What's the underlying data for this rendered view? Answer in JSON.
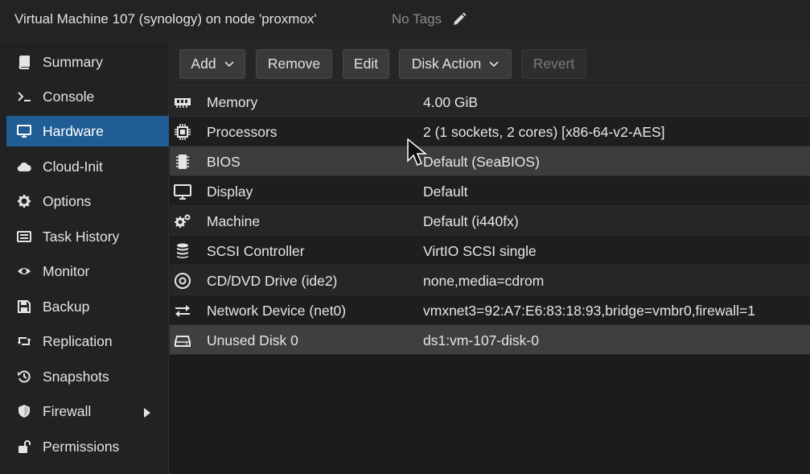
{
  "window": {
    "title": "Virtual Machine 107 (synology) on node 'proxmox'",
    "tags_label": "No Tags",
    "tags_icon": "pencil-icon"
  },
  "sidebar": {
    "items": [
      {
        "label": "Summary",
        "icon": "book-icon"
      },
      {
        "label": "Console",
        "icon": "terminal-icon"
      },
      {
        "label": "Hardware",
        "icon": "monitor-icon",
        "active": true
      },
      {
        "label": "Cloud-Init",
        "icon": "cloud-icon"
      },
      {
        "label": "Options",
        "icon": "gear-icon"
      },
      {
        "label": "Task History",
        "icon": "list-icon"
      },
      {
        "label": "Monitor",
        "icon": "eye-icon"
      },
      {
        "label": "Backup",
        "icon": "floppy-icon"
      },
      {
        "label": "Replication",
        "icon": "retweet-icon"
      },
      {
        "label": "Snapshots",
        "icon": "history-icon"
      },
      {
        "label": "Firewall",
        "icon": "shield-icon",
        "submenu": true
      },
      {
        "label": "Permissions",
        "icon": "unlock-icon"
      }
    ],
    "active_color": "#1f5d94"
  },
  "toolbar": {
    "add_label": "Add",
    "remove_label": "Remove",
    "edit_label": "Edit",
    "disk_action_label": "Disk Action",
    "revert_label": "Revert",
    "revert_disabled": true
  },
  "hardware": {
    "rows": [
      {
        "key": "Memory",
        "value": "4.00 GiB",
        "icon": "memory-icon"
      },
      {
        "key": "Processors",
        "value": "2 (1 sockets, 2 cores) [x86-64-v2-AES]",
        "icon": "cpu-icon"
      },
      {
        "key": "BIOS",
        "value": "Default (SeaBIOS)",
        "icon": "microchip-icon"
      },
      {
        "key": "Display",
        "value": "Default",
        "icon": "desktop-icon"
      },
      {
        "key": "Machine",
        "value": "Default (i440fx)",
        "icon": "cogs-icon"
      },
      {
        "key": "SCSI Controller",
        "value": "VirtIO SCSI single",
        "icon": "database-icon"
      },
      {
        "key": "CD/DVD Drive (ide2)",
        "value": "none,media=cdrom",
        "icon": "cdrom-icon"
      },
      {
        "key": "Network Device (net0)",
        "value": "vmxnet3=92:A7:E6:83:18:93,bridge=vmbr0,firewall=1",
        "icon": "exchange-icon"
      },
      {
        "key": "Unused Disk 0",
        "value": "ds1:vm-107-disk-0",
        "icon": "hdd-icon"
      }
    ],
    "hovered_row": "BIOS",
    "selected_row": "Unused Disk 0"
  }
}
